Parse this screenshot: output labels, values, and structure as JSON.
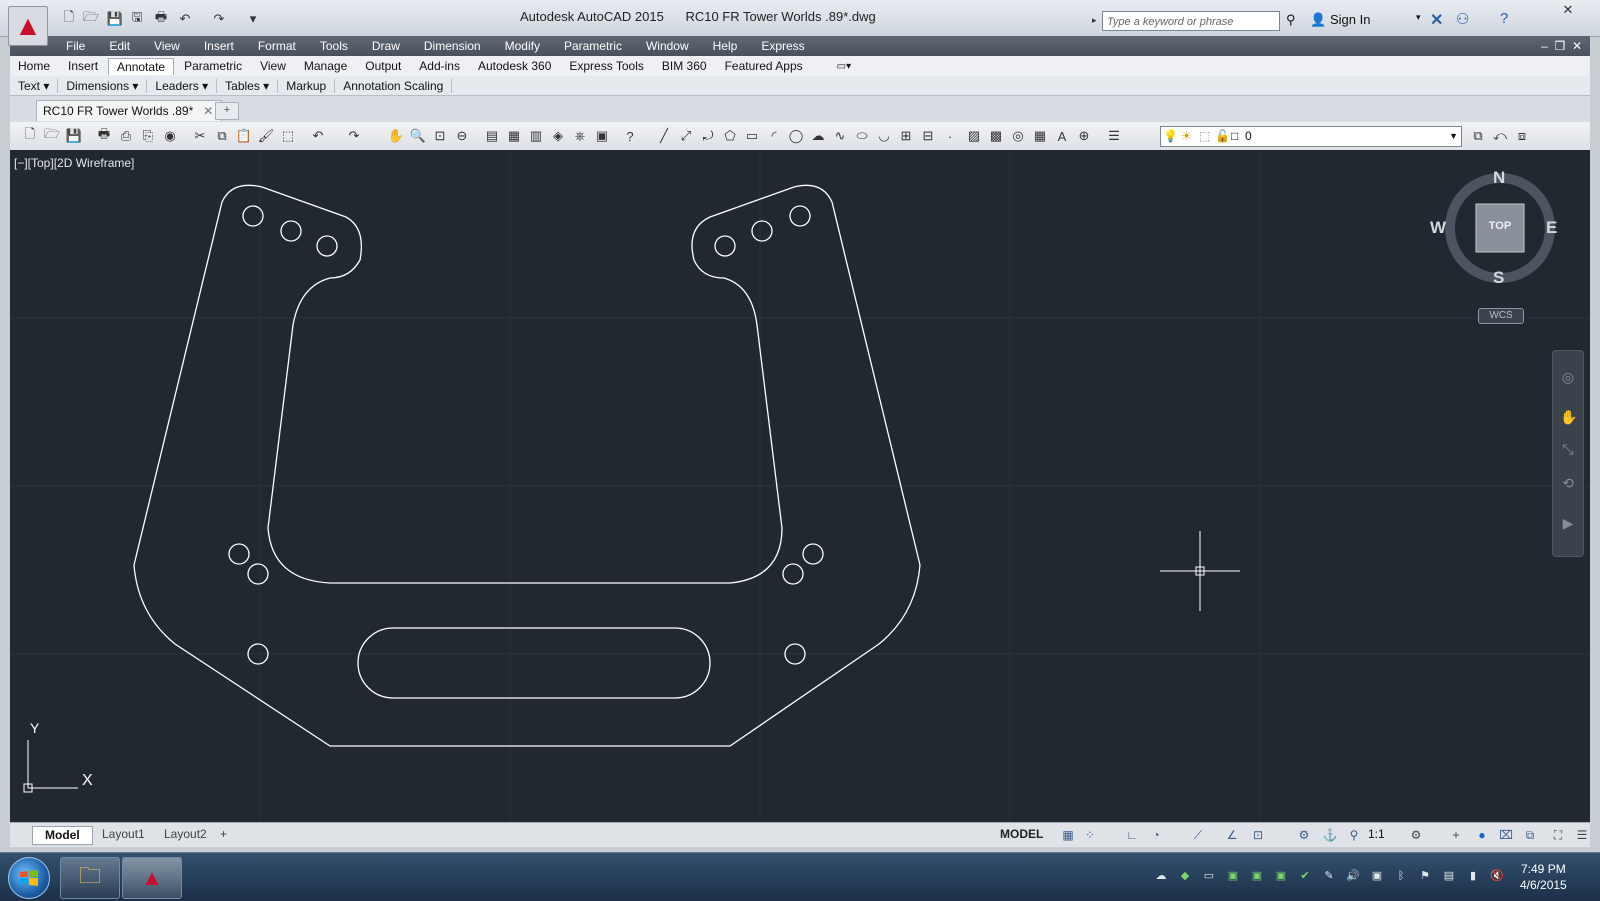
{
  "window": {
    "app_name": "Autodesk AutoCAD 2015",
    "file_name": "RC10 FR Tower Worlds .89*.dwg",
    "search_placeholder": "Type a keyword or phrase",
    "sign_in": "Sign In",
    "close_symbol": "✕"
  },
  "menubar": [
    "File",
    "Edit",
    "View",
    "Insert",
    "Format",
    "Tools",
    "Draw",
    "Dimension",
    "Modify",
    "Parametric",
    "Window",
    "Help",
    "Express"
  ],
  "ribbon_tabs": [
    "Home",
    "Insert",
    "Annotate",
    "Parametric",
    "View",
    "Manage",
    "Output",
    "Add-ins",
    "Autodesk 360",
    "Express Tools",
    "BIM 360",
    "Featured Apps"
  ],
  "active_ribbon_tab": "Annotate",
  "ribbon_panels": [
    "Text ▾",
    "Dimensions ▾",
    "Leaders ▾",
    "Tables ▾",
    "Markup",
    "Annotation Scaling"
  ],
  "file_tab": {
    "label": "RC10 FR Tower Worlds .89*",
    "close": "✕",
    "new_tab": "+"
  },
  "layer_combo": {
    "value": "0"
  },
  "viewport_label": "[−][Top][2D Wireframe]",
  "viewcube": {
    "face": "TOP",
    "north": "N",
    "south": "S",
    "east": "E",
    "west": "W",
    "wcs": "WCS"
  },
  "ucs": {
    "x": "X",
    "y": "Y"
  },
  "layout_tabs": [
    "Model",
    "Layout1",
    "Layout2"
  ],
  "active_layout": "Model",
  "status": {
    "model": "MODEL",
    "scale": "1:1"
  },
  "taskbar": {
    "time": "7:49 PM",
    "date": "4/6/2015"
  },
  "colors": {
    "canvas_bg": "#212830",
    "geometry": "#ffffff",
    "menubar_bg": "#4f5762",
    "autocad_red": "#c8102e"
  }
}
